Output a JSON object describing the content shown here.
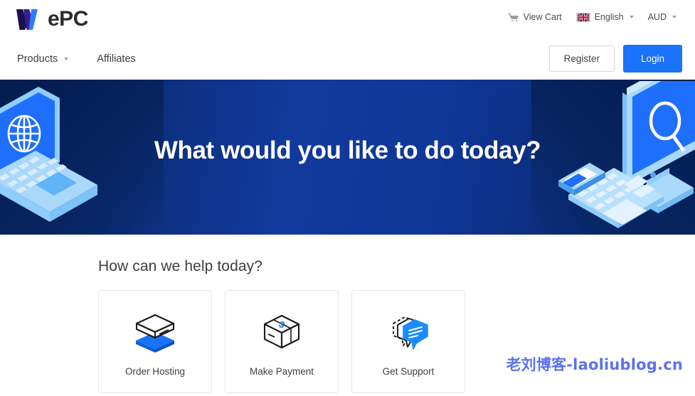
{
  "brand": {
    "name": "WePC",
    "logo_mark": "w-logo-icon",
    "logo_text": "ePC",
    "color_dark": "#1b0f4e",
    "color_accent": "#2f7bff",
    "color_word": "#2b2b2b"
  },
  "topbar": {
    "cart": {
      "icon": "shopping-cart-icon",
      "label": "View Cart"
    },
    "language": {
      "icon": "uk-flag-icon",
      "label": "English",
      "caret": "chevron-down-icon"
    },
    "currency": {
      "label": "AUD",
      "caret": "chevron-down-icon"
    }
  },
  "nav": {
    "items": [
      {
        "label": "Products",
        "has_caret": true
      },
      {
        "label": "Affiliates",
        "has_caret": false
      }
    ],
    "register_label": "Register",
    "login_label": "Login",
    "login_color": "#1a73f8"
  },
  "hero": {
    "title": "What would you like to do today?",
    "background_color": "#123a9e",
    "art_left": "isometric-laptop-globe-illustration",
    "art_right": "isometric-desktop-search-illustration"
  },
  "main": {
    "section_title": "How can we help today?",
    "cards": [
      {
        "label": "Order Hosting",
        "icon": "server-box-icon"
      },
      {
        "label": "Make Payment",
        "icon": "payment-box-dollar-icon"
      },
      {
        "label": "Get Support",
        "icon": "speech-bubbles-icon"
      }
    ]
  },
  "watermark": {
    "text": "老刘博客-laoliublog.cn",
    "color": "#5b72ef"
  }
}
